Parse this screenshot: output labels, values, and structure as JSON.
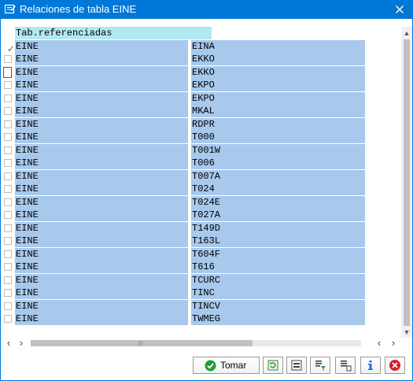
{
  "window": {
    "title": "Relaciones de tabla EINE"
  },
  "table": {
    "header": "Tab.referenciadas",
    "rows": [
      {
        "checked": true,
        "focused": false,
        "col1": "EINE",
        "col2": "EINA"
      },
      {
        "checked": false,
        "focused": false,
        "col1": "EINE",
        "col2": "EKKO"
      },
      {
        "checked": false,
        "focused": true,
        "col1": "EINE",
        "col2": "EKKO"
      },
      {
        "checked": false,
        "focused": false,
        "col1": "EINE",
        "col2": "EKPO"
      },
      {
        "checked": false,
        "focused": false,
        "col1": "EINE",
        "col2": "EKPO"
      },
      {
        "checked": false,
        "focused": false,
        "col1": "EINE",
        "col2": "MKAL"
      },
      {
        "checked": false,
        "focused": false,
        "col1": "EINE",
        "col2": "RDPR"
      },
      {
        "checked": false,
        "focused": false,
        "col1": "EINE",
        "col2": "T000"
      },
      {
        "checked": false,
        "focused": false,
        "col1": "EINE",
        "col2": "T001W"
      },
      {
        "checked": false,
        "focused": false,
        "col1": "EINE",
        "col2": "T006"
      },
      {
        "checked": false,
        "focused": false,
        "col1": "EINE",
        "col2": "T007A"
      },
      {
        "checked": false,
        "focused": false,
        "col1": "EINE",
        "col2": "T024"
      },
      {
        "checked": false,
        "focused": false,
        "col1": "EINE",
        "col2": "T024E"
      },
      {
        "checked": false,
        "focused": false,
        "col1": "EINE",
        "col2": "T027A"
      },
      {
        "checked": false,
        "focused": false,
        "col1": "EINE",
        "col2": "T149D"
      },
      {
        "checked": false,
        "focused": false,
        "col1": "EINE",
        "col2": "T163L"
      },
      {
        "checked": false,
        "focused": false,
        "col1": "EINE",
        "col2": "T604F"
      },
      {
        "checked": false,
        "focused": false,
        "col1": "EINE",
        "col2": "T616"
      },
      {
        "checked": false,
        "focused": false,
        "col1": "EINE",
        "col2": "TCURC"
      },
      {
        "checked": false,
        "focused": false,
        "col1": "EINE",
        "col2": "TINC"
      },
      {
        "checked": false,
        "focused": false,
        "col1": "EINE",
        "col2": "TINCV"
      },
      {
        "checked": false,
        "focused": false,
        "col1": "EINE",
        "col2": "TWMEG"
      }
    ]
  },
  "scroll": {
    "horizontal_grip": "|||"
  },
  "toolbar": {
    "tomar_label": "Tomar",
    "icons": [
      "check-circle-icon",
      "refresh-icon",
      "select-all-icon",
      "filter-icon",
      "detail-icon",
      "info-icon",
      "cancel-icon"
    ]
  },
  "colors": {
    "titlebar": "#0078d7",
    "cell": "#a8c8ec",
    "header": "#b2e8f2",
    "focus": "#d21f2d",
    "ok": "#1f9e3a",
    "cancel": "#d21f2d",
    "info": "#1a6fd1"
  }
}
